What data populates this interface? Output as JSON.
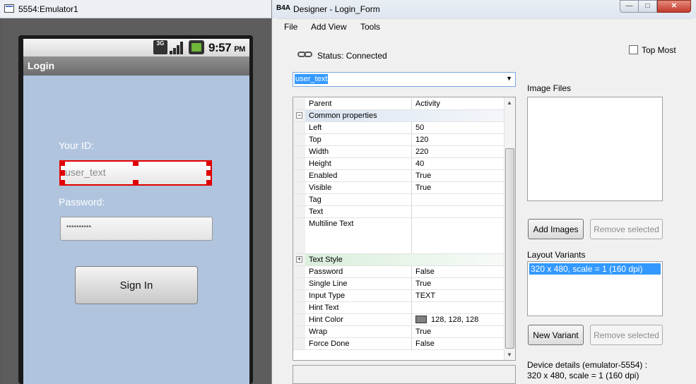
{
  "emulator": {
    "title": "5554:Emulator1",
    "status_bar": {
      "network": "3G",
      "time": "9:57",
      "ampm": "PM"
    },
    "activity_title": "Login",
    "id_label": "Your ID:",
    "user_text": "user_text",
    "password_label": "Password:",
    "password_mask": "••••••••••",
    "signin_label": "Sign In"
  },
  "designer": {
    "logo": "B4A",
    "title": "Designer - Login_Form",
    "window_buttons": {
      "minimize": "—",
      "maximize": "□",
      "close": "✕"
    },
    "menu": {
      "file": "File",
      "add_view": "Add View",
      "tools": "Tools"
    },
    "status": "Status: Connected",
    "top_most": "Top Most",
    "selected_view": "user_text",
    "properties": [
      {
        "name": "Parent",
        "value": "Activity"
      },
      {
        "name": "Common properties",
        "category": true,
        "expander": "−"
      },
      {
        "name": "Left",
        "value": "50"
      },
      {
        "name": "Top",
        "value": "120"
      },
      {
        "name": "Width",
        "value": "220"
      },
      {
        "name": "Height",
        "value": "40"
      },
      {
        "name": "Enabled",
        "value": "True"
      },
      {
        "name": "Visible",
        "value": "True"
      },
      {
        "name": "Tag",
        "value": ""
      },
      {
        "name": "Text",
        "value": ""
      },
      {
        "name": "Multiline Text",
        "value": ""
      },
      {
        "name": "Text Style",
        "category": true,
        "expander": "+"
      },
      {
        "name": "Password",
        "value": "False"
      },
      {
        "name": "Single Line",
        "value": "True"
      },
      {
        "name": "Input Type",
        "value": "TEXT"
      },
      {
        "name": "Hint Text",
        "value": ""
      },
      {
        "name": "Hint Color",
        "value": "128, 128, 128",
        "swatch": "#808080"
      },
      {
        "name": "Wrap",
        "value": "True"
      },
      {
        "name": "Force Done",
        "value": "False"
      }
    ],
    "image_files_label": "Image Files",
    "add_images": "Add Images",
    "remove_selected_images": "Remove selected",
    "layout_variants_label": "Layout Variants",
    "variants": [
      "320 x 480, scale = 1 (160 dpi)"
    ],
    "new_variant": "New Variant",
    "remove_selected_variant": "Remove selected",
    "device_details_line1": "Device details (emulator-5554) :",
    "device_details_line2": "320 x 480, scale = 1 (160 dpi)"
  }
}
